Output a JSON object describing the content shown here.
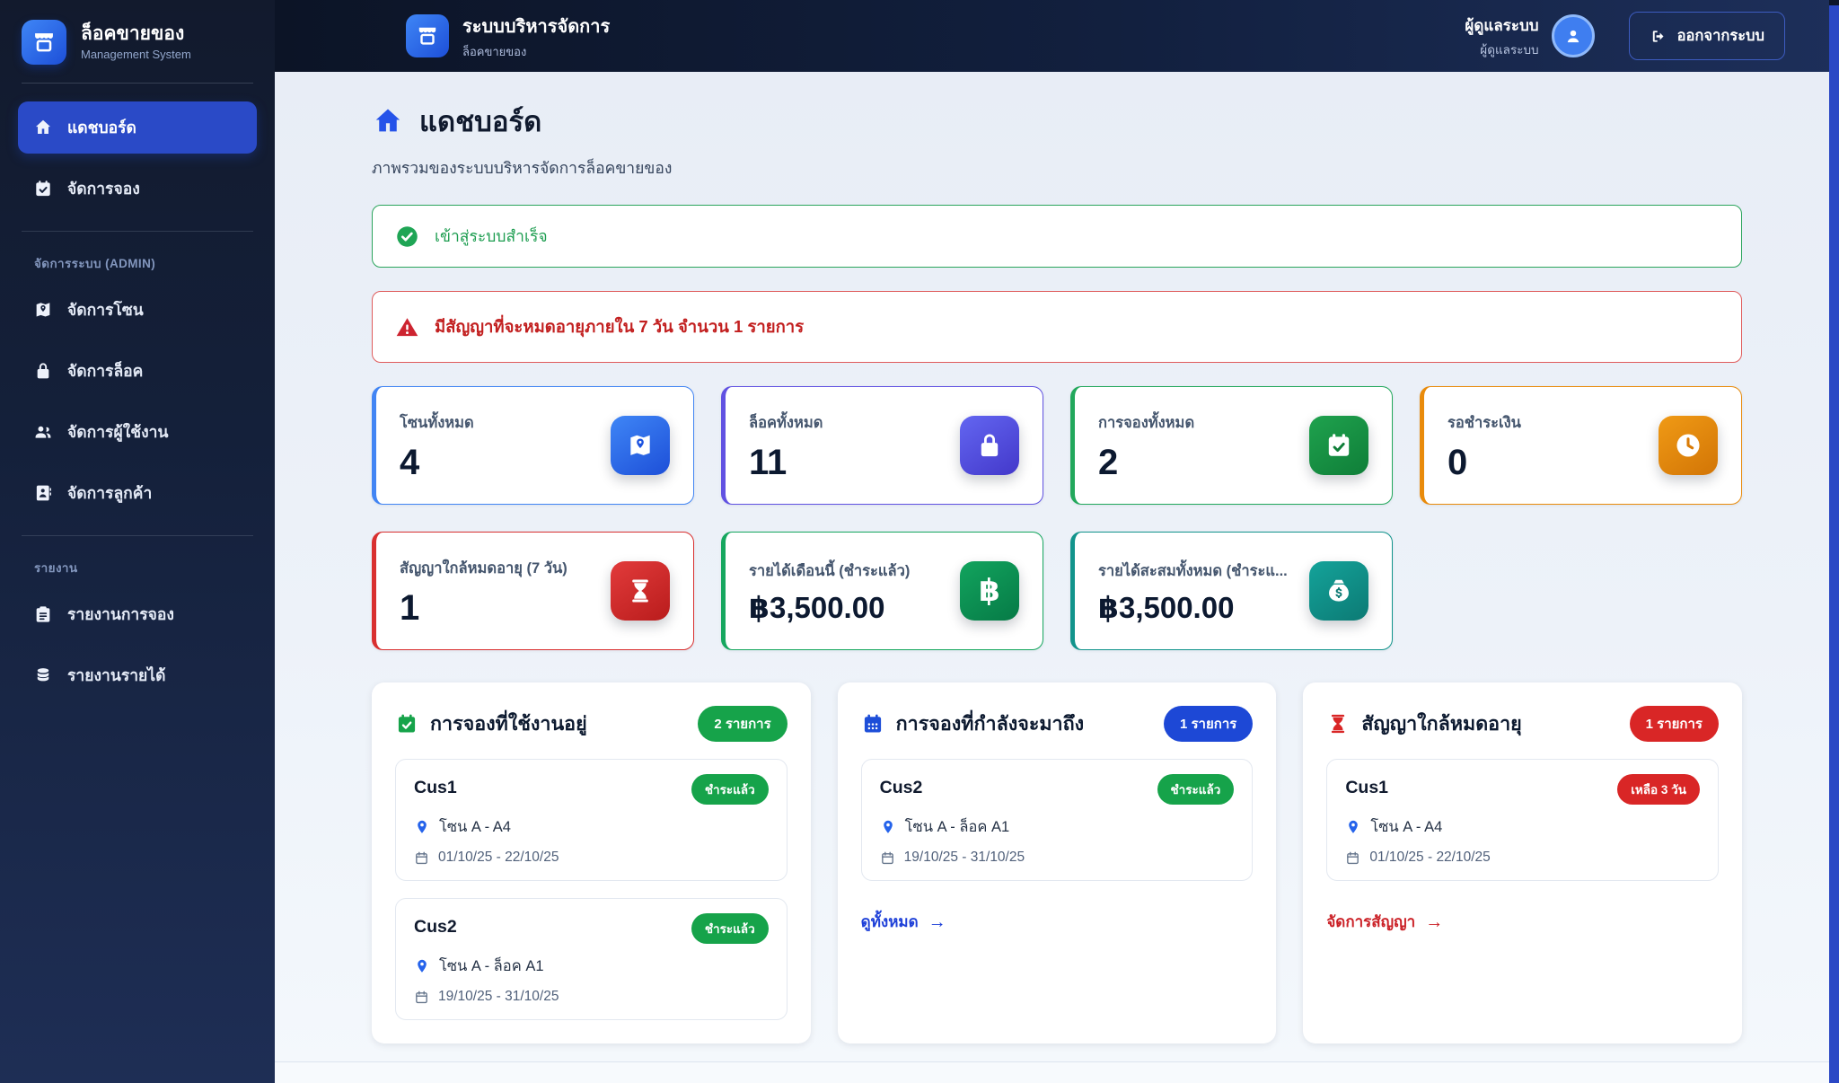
{
  "colors": {
    "sidebar_bg": "#14203a",
    "active_nav": "#2a4ac7",
    "accent_blue": "#2563eb",
    "success_green": "#16a34a",
    "danger_red": "#d92626",
    "warn_orange": "#e98b0b",
    "indigo": "#4f46e5",
    "emerald": "#0f9d58",
    "teal": "#0d9488",
    "scrollbar_blue": "#2b48c5"
  },
  "sidebar": {
    "logo": {
      "icon": "storefront-icon",
      "title": "ล็อคขายของ",
      "subtitle": "Management System"
    },
    "sections": [
      {
        "label": "",
        "items": [
          {
            "icon": "home-icon",
            "label": "แดชบอร์ด",
            "active": true
          },
          {
            "icon": "calendar-check-icon",
            "label": "จัดการจอง",
            "active": false
          }
        ]
      },
      {
        "label": "จัดการระบบ (ADMIN)",
        "items": [
          {
            "icon": "map-icon",
            "label": "จัดการโซน"
          },
          {
            "icon": "lock-icon",
            "label": "จัดการล็อค"
          },
          {
            "icon": "users-icon",
            "label": "จัดการผู้ใช้งาน"
          },
          {
            "icon": "contact-card-icon",
            "label": "จัดการลูกค้า"
          }
        ]
      },
      {
        "label": "รายงาน",
        "items": [
          {
            "icon": "clipboard-icon",
            "label": "รายงานการจอง"
          },
          {
            "icon": "coins-icon",
            "label": "รายงานรายได้"
          }
        ]
      }
    ]
  },
  "header": {
    "icon": "storefront-icon",
    "title": "ระบบบริหารจัดการ",
    "subtitle": "ล็อคขายของ",
    "user_name": "ผู้ดูแลระบบ",
    "user_role": "ผู้ดูแลระบบ",
    "avatar_icon": "user-icon",
    "logout_label": "ออกจากระบบ",
    "logout_icon": "logout-icon"
  },
  "page": {
    "icon": "home-icon",
    "title": "แดชบอร์ด",
    "subtitle": "ภาพรวมของระบบบริหารจัดการล็อคขายของ"
  },
  "alerts": {
    "success": {
      "icon": "check-circle-icon",
      "text": "เข้าสู่ระบบสำเร็จ"
    },
    "warning": {
      "icon": "warning-triangle-icon",
      "text": "มีสัญญาที่จะหมดอายุภายใน 7 วัน จำนวน 1 รายการ"
    }
  },
  "stats": [
    {
      "label": "โซนทั้งหมด",
      "value": "4",
      "icon": "map-icon",
      "color": "#4285f4"
    },
    {
      "label": "ล็อคทั้งหมด",
      "value": "11",
      "icon": "lock-icon",
      "color": "#6152e2"
    },
    {
      "label": "การจองทั้งหมด",
      "value": "2",
      "icon": "calendar-check-icon",
      "color": "#22a85c"
    },
    {
      "label": "รอชำระเงิน",
      "value": "0",
      "icon": "clock-icon",
      "color": "#e98b0b"
    },
    {
      "label": "สัญญาใกล้หมดอายุ (7 วัน)",
      "value": "1",
      "icon": "hourglass-icon",
      "color": "#d93030"
    },
    {
      "label": "รายได้เดือนนี้ (ชำระแล้ว)",
      "value": "฿3,500.00",
      "icon": "baht-icon",
      "color": "#16a75f"
    },
    {
      "label": "รายได้สะสมทั้งหมด (ชำระแ...",
      "value": "฿3,500.00",
      "icon": "money-bag-icon",
      "color": "#12948c"
    }
  ],
  "panels": [
    {
      "icon": "calendar-check-icon",
      "title": "การจองที่ใช้งานอยู่",
      "badge": "2 รายการ",
      "accent": "#16a34a",
      "items": [
        {
          "name": "Cus1",
          "badge": "ชำระแล้ว",
          "location": "โซน A - A4",
          "dates": "01/10/25  -  22/10/25"
        },
        {
          "name": "Cus2",
          "badge": "ชำระแล้ว",
          "location": "โซน A - ล็อค A1",
          "dates": "19/10/25  -  31/10/25"
        }
      ],
      "footer_link": ""
    },
    {
      "icon": "calendar-days-icon",
      "title": "การจองที่กำลังจะมาถึง",
      "badge": "1 รายการ",
      "accent": "#1d4ed8",
      "items": [
        {
          "name": "Cus2",
          "badge": "ชำระแล้ว",
          "location": "โซน A - ล็อค A1",
          "dates": "19/10/25  -  31/10/25"
        }
      ],
      "footer_link": "ดูทั้งหมด"
    },
    {
      "icon": "hourglass-icon",
      "title": "สัญญาใกล้หมดอายุ",
      "badge": "1 รายการ",
      "accent": "#d92626",
      "items": [
        {
          "name": "Cus1",
          "badge": "เหลือ 3 วัน",
          "location": "โซน A - A4",
          "dates": "01/10/25  -  22/10/25"
        }
      ],
      "footer_link": "จัดการสัญญา"
    }
  ]
}
